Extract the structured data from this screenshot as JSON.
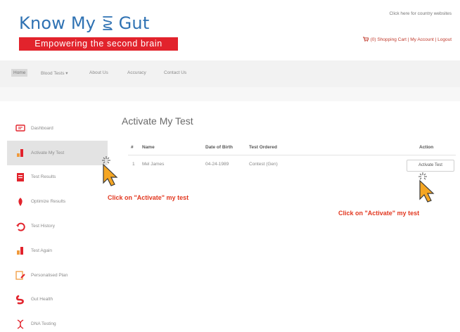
{
  "header": {
    "logo_text": "Know My",
    "logo_text_2": "Gut",
    "tagline": "Empowering the second brain",
    "country_link": "Click here for country websites",
    "top_links": "(0) Shopping Cart | My Account | Logout"
  },
  "nav": {
    "items": [
      {
        "label": "Home"
      },
      {
        "label": "Blood Tests ▾"
      },
      {
        "label": "About Us"
      },
      {
        "label": "Accuracy"
      },
      {
        "label": "Contact Us"
      }
    ]
  },
  "sidebar": {
    "items": [
      {
        "label": "Dashboard",
        "icon": "dashboard-icon"
      },
      {
        "label": "Activate My Test",
        "icon": "activate-test-icon"
      },
      {
        "label": "Test Results",
        "icon": "test-results-icon"
      },
      {
        "label": "Optimize Results",
        "icon": "optimize-results-icon"
      },
      {
        "label": "Test History",
        "icon": "test-history-icon"
      },
      {
        "label": "Test Again",
        "icon": "test-again-icon"
      },
      {
        "label": "Personalised Plan",
        "icon": "personalised-plan-icon"
      },
      {
        "label": "Gut Health",
        "icon": "gut-health-icon"
      },
      {
        "label": "DNA Testing",
        "icon": "dna-testing-icon"
      }
    ]
  },
  "main": {
    "title": "Activate My Test",
    "table": {
      "headers": [
        "#",
        "Name",
        "Date of Birth",
        "Test Ordered",
        "Action"
      ],
      "rows": [
        {
          "num": "1",
          "name": "Mel James",
          "dob": "04-24-1989",
          "test": "Contest (Gen)",
          "action": "Activate Test"
        }
      ]
    }
  },
  "annotations": {
    "left": "Click on \"Activate\" my test",
    "right": "Click on \"Activate\" my test"
  },
  "colors": {
    "brand_blue": "#2f72b3",
    "brand_red": "#e2232c",
    "annotation_red": "#e2371f",
    "cursor_orange": "#f5a623"
  }
}
